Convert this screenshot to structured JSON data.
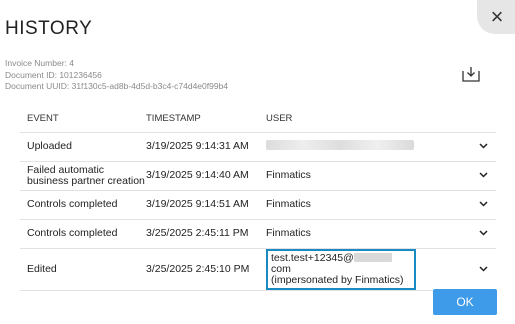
{
  "dialog": {
    "title": "HISTORY",
    "close_glyph": "×",
    "ok_label": "OK"
  },
  "meta": {
    "invoice_number": "Invoice Number: 4",
    "document_id": "Document ID: 101236456",
    "document_uuid": "Document UUID: 31f130c5-ad8b-4d5d-b3c4-c74d4e0f99b4"
  },
  "table": {
    "headers": {
      "event": "EVENT",
      "timestamp": "TIMESTAMP",
      "user": "USER"
    },
    "rows": [
      {
        "event": "Uploaded",
        "timestamp": "3/19/2025 9:14:31 AM",
        "user": ""
      },
      {
        "event": "Failed automatic business partner creation",
        "timestamp": "3/19/2025 9:14:40 AM",
        "user": "Finmatics"
      },
      {
        "event": "Controls completed",
        "timestamp": "3/19/2025 9:14:51 AM",
        "user": "Finmatics"
      },
      {
        "event": "Controls completed",
        "timestamp": "3/25/2025 2:45:11 PM",
        "user": "Finmatics"
      },
      {
        "event": "Edited",
        "timestamp": "3/25/2025 2:45:10 PM",
        "user_prefix": "test.test+12345@",
        "user_suffix": "com",
        "user_line2": "(impersonated by Finmatics)"
      }
    ]
  },
  "colors": {
    "accent": "#3d9be9",
    "highlight": "#1a8bc2"
  },
  "icons": {
    "download": "download-icon",
    "close": "close-icon",
    "expand": "chevron-down-icon"
  }
}
